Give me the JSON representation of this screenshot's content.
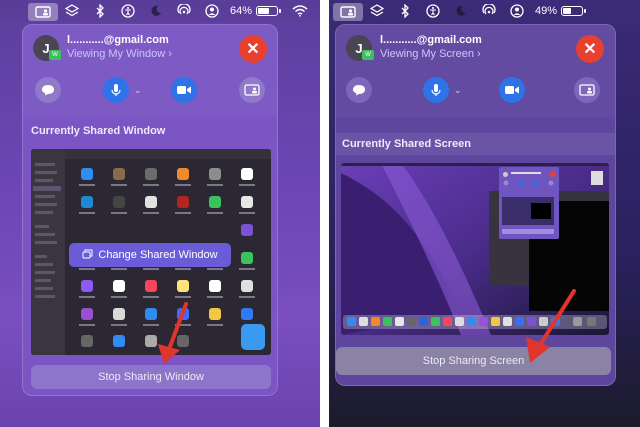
{
  "left": {
    "menubar": {
      "battery_percent": "64%",
      "battery_level": 0.64
    },
    "panel": {
      "avatar_initial": "J",
      "avatar_badge": "W",
      "email_visible": "l...........@gmail.com",
      "viewing_label": "Viewing My Window ›",
      "section_title": "Currently Shared Window",
      "change_button_label": "Change Shared Window",
      "stop_button_label": "Stop Sharing Window"
    }
  },
  "right": {
    "menubar": {
      "battery_percent": "49%",
      "battery_level": 0.49
    },
    "panel": {
      "avatar_initial": "J",
      "avatar_badge": "W",
      "email_visible": "l...........@gmail.com",
      "viewing_label": "Viewing My Screen ›",
      "section_title": "Currently Shared Screen",
      "stop_button_label": "Stop Sharing Screen"
    }
  },
  "icons": [
    "screen-share-icon",
    "layers-icon",
    "bluetooth-icon",
    "accessibility-icon",
    "moon-icon",
    "airplay-icon",
    "user-icon",
    "wifi-icon",
    "chat-icon",
    "microphone-icon",
    "video-icon",
    "share-screen-icon",
    "close-icon"
  ],
  "colors": {
    "close_red": "#e8402f",
    "accent_blue": "#2e73e8",
    "arrow_red": "#e0352b"
  }
}
